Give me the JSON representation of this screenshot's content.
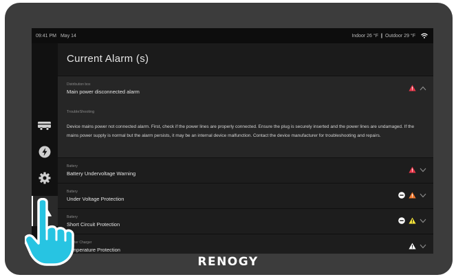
{
  "status_bar": {
    "time": "09:41 PM",
    "date": "May 14",
    "indoor": "Indoor 26 °F",
    "separator": "|",
    "outdoor": "Outdoor 29 °F"
  },
  "sidebar": {
    "items": [
      {
        "icon": "rv-icon",
        "active": false
      },
      {
        "icon": "lightning-icon",
        "active": false
      },
      {
        "icon": "gear-icon",
        "active": false
      },
      {
        "icon": "warning-icon",
        "active": true
      }
    ]
  },
  "main": {
    "title": "Current Alarm (s)",
    "alarms": [
      {
        "category": "Distribution box",
        "name": "Main power disconnected alarm",
        "expanded": true,
        "troubleshooting_label": "TroubleShooting",
        "troubleshooting_text": "Device mains power not connected alarm. First, check if the power lines are properly connected. Ensure the plug is securely inserted and the power lines are undamaged. If the mains power supply is normal but the alarm persists, it may be an internal device malfunction. Contact the device manufacturer for troubleshooting and repairs."
      },
      {
        "category": "Battery",
        "name": "Battery Undervoltage Warning"
      },
      {
        "category": "Battery",
        "name": "Under Voltage Protection"
      },
      {
        "category": "Battery",
        "name": "Short Circuit Protection"
      },
      {
        "category": "Inverter Charger",
        "name": "Temperature Protection"
      }
    ]
  },
  "brand": "RENOGY",
  "colors": {
    "alarm_red": "#e8374a",
    "alarm_orange": "#f0792f",
    "alarm_yellow": "#f3e23a",
    "alarm_white": "#ffffff",
    "hand_cyan": "#27c4e2"
  }
}
